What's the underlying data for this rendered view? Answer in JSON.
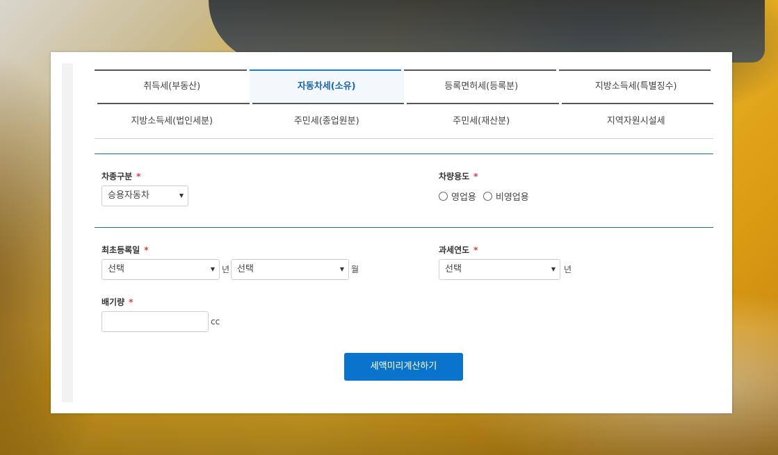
{
  "tabs": {
    "row1": [
      "취득세(부동산)",
      "자동차세(소유)",
      "등록면허세(등록분)",
      "지방소득세(특별징수)"
    ],
    "row2": [
      "지방소득세(법인세분)",
      "주민세(종업원분)",
      "주민세(재산분)",
      "지역자원시설세"
    ],
    "active": "자동차세(소유)"
  },
  "form": {
    "vehicle_type": {
      "label": "차종구분",
      "required": "*",
      "value": "승용자동차"
    },
    "vehicle_use": {
      "label": "차량용도",
      "required": "*",
      "options": [
        "영업용",
        "비영업용"
      ]
    },
    "first_registration": {
      "label": "최초등록일",
      "required": "*",
      "year_value": "선택",
      "year_unit": "년",
      "month_value": "선택",
      "month_unit": "월"
    },
    "tax_year": {
      "label": "과세연도",
      "required": "*",
      "value": "선택",
      "unit": "년"
    },
    "displacement": {
      "label": "배기량",
      "required": "*",
      "value": "",
      "unit": "cc"
    }
  },
  "submit_label": "세액미리계산하기",
  "colors": {
    "accent": "#0a73cc",
    "required": "#e03a3a",
    "divider": "#1a6aa6"
  }
}
